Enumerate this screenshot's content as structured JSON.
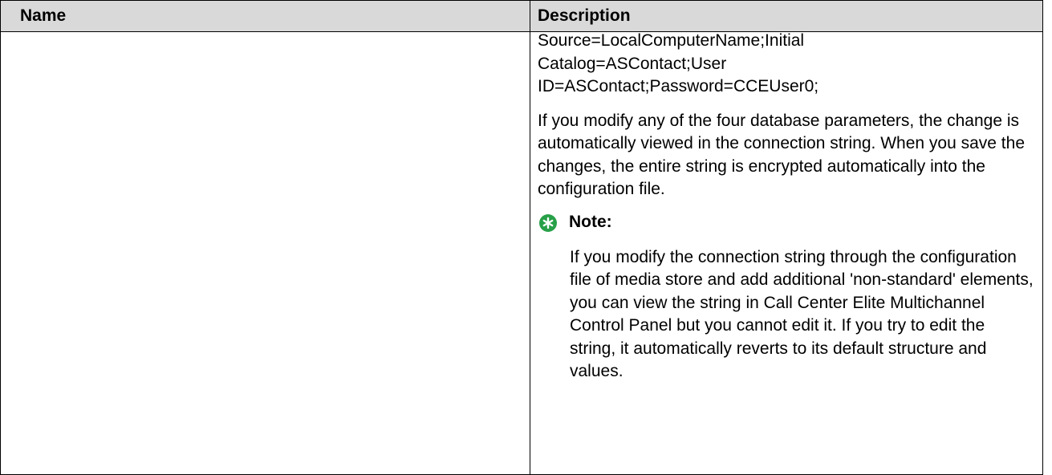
{
  "table": {
    "headers": {
      "name": "Name",
      "description": "Description"
    },
    "row": {
      "name": "",
      "description": {
        "connection_string_lines": [
          "Source=LocalComputerName;Initial",
          "Catalog=ASContact;User",
          "ID=ASContact;Password=CCEUser0;"
        ],
        "paragraph": "If you modify any of the four database parameters, the change is automatically viewed in the connection string. When you save the changes, the entire string is encrypted automatically into the configuration file.",
        "note": {
          "icon": "asterisk-note-icon",
          "icon_color": "#27a048",
          "label": "Note:",
          "text": "If you modify the connection string through the configuration file of media store and add additional 'non-standard' elements, you can view the string in Call Center Elite Multichannel Control Panel but you cannot edit it. If you try to edit the string, it automatically reverts to its default structure and values."
        }
      }
    },
    "header_bg": "#d9d9d9"
  }
}
